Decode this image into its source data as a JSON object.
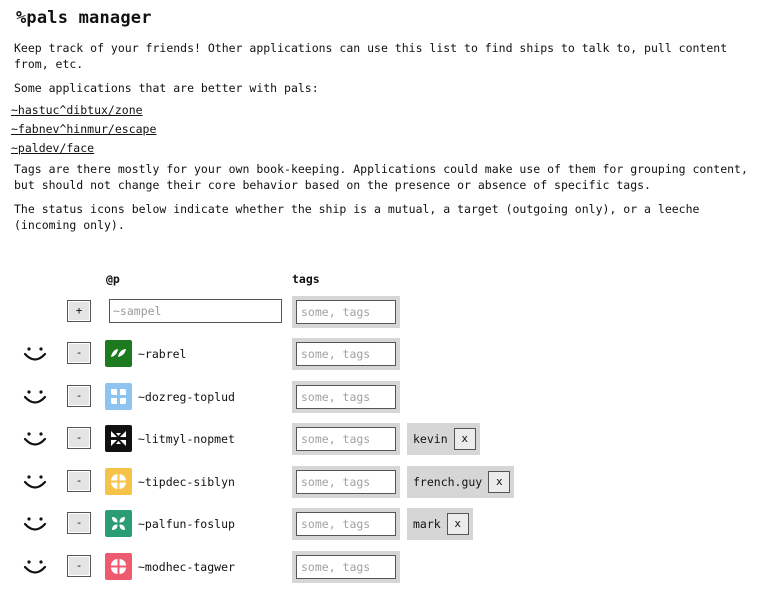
{
  "title": "%pals manager",
  "intro": "Keep track of your friends! Other applications can use this list to find ships to talk to, pull content from, etc.",
  "apps_heading": "Some applications that are better with pals:",
  "apps": [
    {
      "label": "~hastuc^dibtux/zone"
    },
    {
      "label": "~fabnev^hinmur/escape"
    },
    {
      "label": "~paldev/face"
    }
  ],
  "tags_note": "Tags are there mostly for your own book-keeping. Applications could make use of them for grouping content, but should not change their core behavior based on the presence or absence of specific tags.",
  "status_note": "The status icons below indicate whether the ship is a mutual, a target (outgoing only), or a leeche (incoming only).",
  "table": {
    "col_ship": "@p",
    "col_tags": "tags",
    "add_button": "+",
    "ship_placeholder": "~sampel",
    "tags_placeholder": "some, tags",
    "remove_button": "-",
    "chip_remove": "x"
  },
  "pals": [
    {
      "ship": "~rabrel",
      "status": "mutual",
      "avatar_color": "#1e7a1e",
      "avatar_fg": "#ffffff",
      "tags": []
    },
    {
      "ship": "~dozreg-toplud",
      "status": "mutual",
      "avatar_color": "#8fc4f2",
      "avatar_fg": "#ffffff",
      "tags": []
    },
    {
      "ship": "~litmyl-nopmet",
      "status": "mutual",
      "avatar_color": "#111111",
      "avatar_fg": "#ffffff",
      "tags": [
        "kevin"
      ]
    },
    {
      "ship": "~tipdec-siblyn",
      "status": "mutual",
      "avatar_color": "#f5c24a",
      "avatar_fg": "#ffffff",
      "tags": [
        "french.guy"
      ]
    },
    {
      "ship": "~palfun-foslup",
      "status": "mutual",
      "avatar_color": "#2a9d74",
      "avatar_fg": "#ffffff",
      "tags": [
        "mark"
      ]
    },
    {
      "ship": "~modhec-tagwer",
      "status": "mutual",
      "avatar_color": "#ee5a6e",
      "avatar_fg": "#ffffff",
      "tags": []
    }
  ]
}
